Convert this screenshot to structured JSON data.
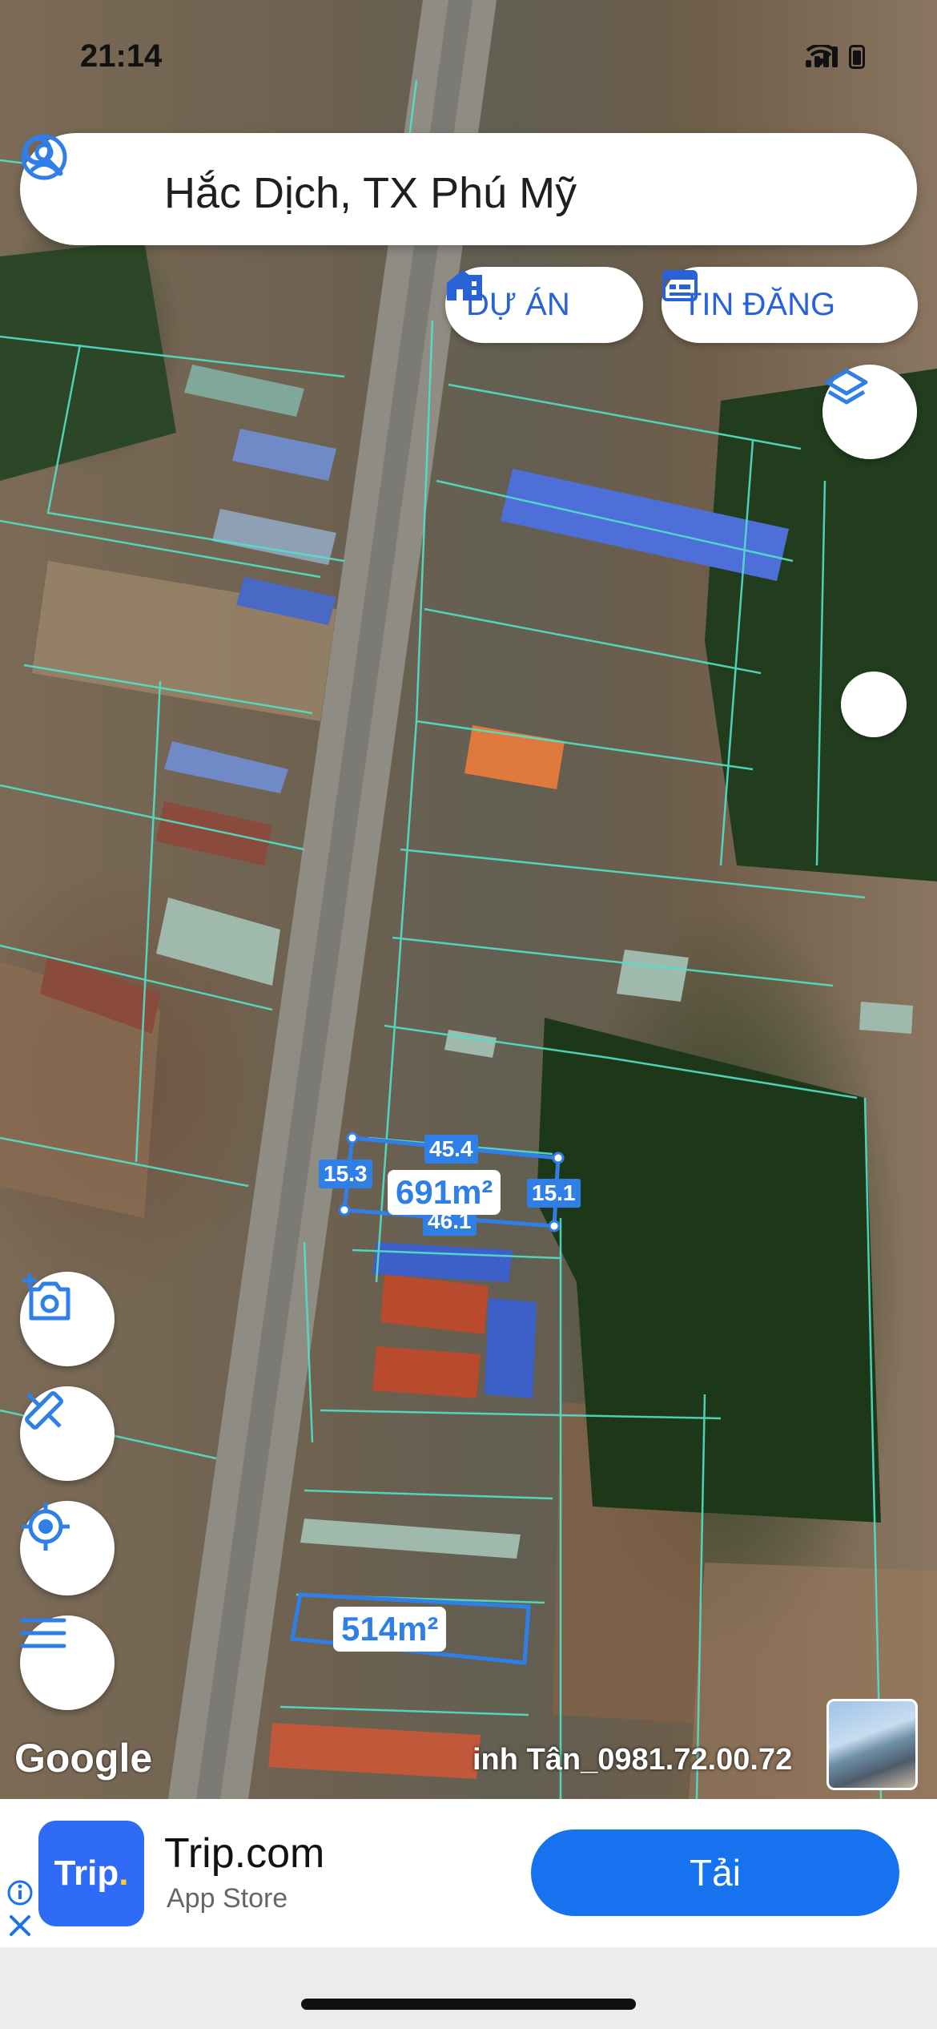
{
  "status_bar": {
    "time": "21:14"
  },
  "search": {
    "query": "Hắc Dịch, TX Phú Mỹ"
  },
  "chips": {
    "du_an": "DỰ ÁN",
    "tin_dang": "TIN ĐĂNG"
  },
  "parcels": {
    "parcel_1": {
      "top": "45.4",
      "left": "15.3",
      "right": "15.1",
      "bottom": "46.1",
      "area": "691m²"
    },
    "parcel_2": {
      "area": "514m²"
    }
  },
  "map": {
    "attribution": "Google",
    "watermark": "inh Tân_0981.72.00.72"
  },
  "ad": {
    "title": "Trip.com",
    "subtitle": "App Store",
    "cta": "Tải",
    "logo_text": "Trip",
    "logo_dot": "."
  },
  "icons": [
    "user-icon",
    "search-icon",
    "building-icon",
    "calendar-icon",
    "layers-icon",
    "camera-add-icon",
    "measure-icon",
    "locate-icon",
    "menu-icon",
    "info-icon",
    "close-icon"
  ],
  "colors": {
    "accent": "#2962d6",
    "parcel_label": "#2f7fe6",
    "cta": "#1672ef"
  }
}
